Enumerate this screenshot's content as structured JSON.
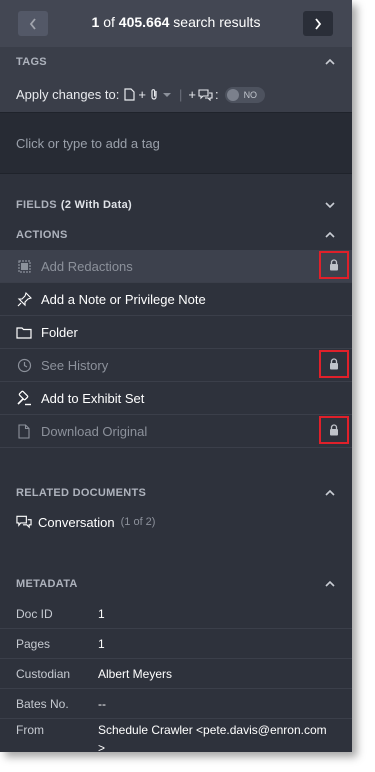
{
  "nav": {
    "current": "1",
    "of_word": "of",
    "total": "405.664",
    "suffix": "search results"
  },
  "tags": {
    "header": "TAGS",
    "apply_label": "Apply changes to:",
    "plus_one": "+",
    "plus_two": "+",
    "toggle_label": "NO",
    "placeholder": "Click or type to add a tag"
  },
  "fields": {
    "header": "FIELDS",
    "count": "(2 With Data)"
  },
  "actions": {
    "header": "ACTIONS",
    "items": [
      {
        "label": "Add Redactions",
        "icon": "redaction-icon",
        "locked": true
      },
      {
        "label": "Add a Note or Privilege Note",
        "icon": "note-pin-icon",
        "locked": false
      },
      {
        "label": "Folder",
        "icon": "folder-icon",
        "locked": false
      },
      {
        "label": "See History",
        "icon": "clock-icon",
        "locked": true
      },
      {
        "label": "Add to Exhibit Set",
        "icon": "gavel-icon",
        "locked": false
      },
      {
        "label": "Download Original",
        "icon": "file-icon",
        "locked": true
      }
    ]
  },
  "related": {
    "header": "RELATED DOCUMENTS",
    "item_label": "Conversation",
    "item_count": "(1 of 2)"
  },
  "metadata": {
    "header": "METADATA",
    "rows": [
      {
        "key": "Doc ID",
        "value": "1"
      },
      {
        "key": "Pages",
        "value": "1"
      },
      {
        "key": "Custodian",
        "value": "Albert Meyers"
      },
      {
        "key": "Bates No.",
        "value": "--"
      },
      {
        "key": "From",
        "value": "Schedule Crawler <pete.davis@enron.com"
      },
      {
        "key": "",
        "value": ">"
      }
    ]
  },
  "colors": {
    "panel": "#2e323c",
    "lock_highlight": "#e0202a"
  }
}
